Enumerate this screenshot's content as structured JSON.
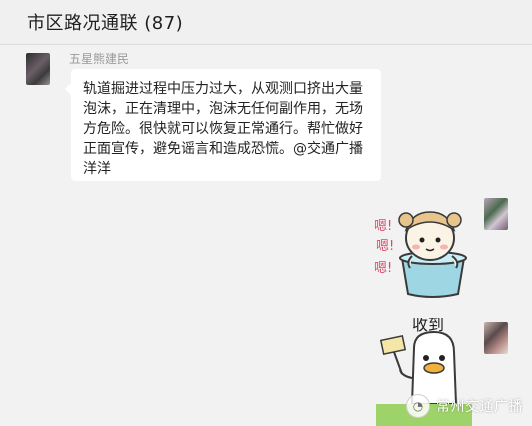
{
  "chat": {
    "title": "市区路况通联 (87)"
  },
  "messages": [
    {
      "sender": "五星熊建民",
      "text": "轨道掘进过程中压力过大，从观测口挤出大量泡沫，正在清理中，泡沫无任何副作用，无场方危险。很快就可以恢复正常通行。帮忙做好正面宣传，避免谣言和造成恐慌。@交通广播 洋洋"
    }
  ],
  "stickers": [
    {
      "icon": "sticker-girl-in-tub",
      "text": [
        "嗯!",
        "嗯!",
        "嗯!"
      ]
    },
    {
      "icon": "sticker-duck-holding-sign",
      "text": "收到"
    }
  ],
  "watermark": {
    "text": "常州交通广播",
    "icon": "wechat-logo-icon"
  },
  "colors": {
    "background": "#f2f2f2",
    "bubble": "#ffffff",
    "accent_green": "#9ed36a"
  }
}
